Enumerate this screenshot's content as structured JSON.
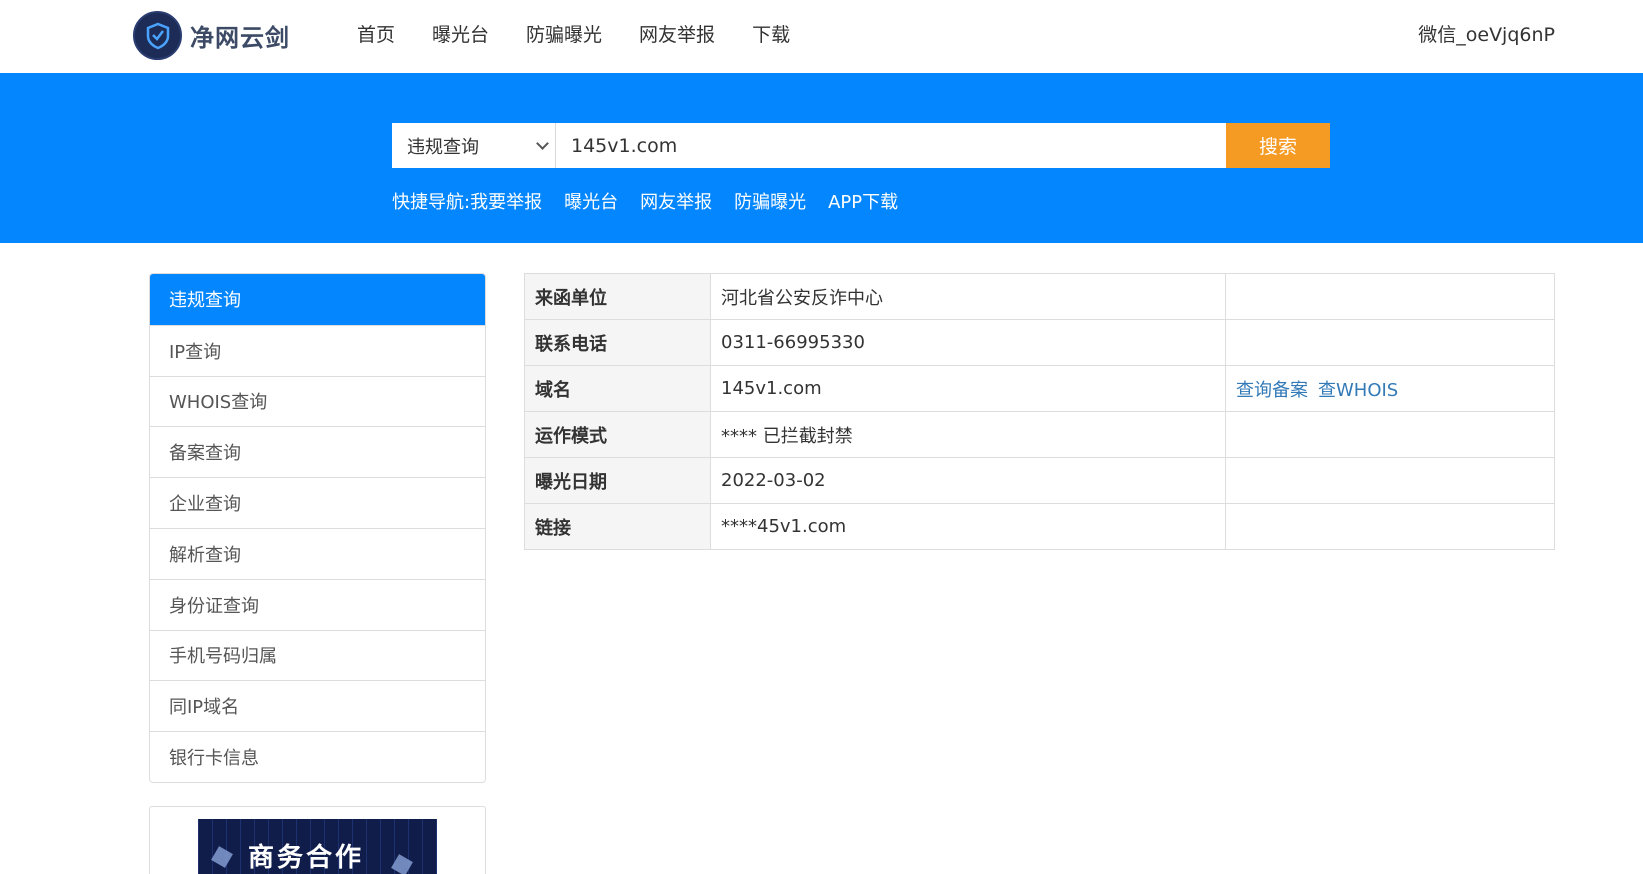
{
  "header": {
    "logo_text": "净网云剑",
    "nav": [
      "首页",
      "曝光台",
      "防骗曝光",
      "网友举报",
      "下载"
    ],
    "user": "微信_oeVjq6nP"
  },
  "search": {
    "select_value": "违规查询",
    "input_value": "145v1.com",
    "button_label": "搜索"
  },
  "quick_nav": {
    "label": "快捷导航:",
    "links": [
      "我要举报",
      "曝光台",
      "网友举报",
      "防骗曝光",
      "APP下载"
    ]
  },
  "sidebar": {
    "items": [
      {
        "label": "违规查询",
        "active": true
      },
      {
        "label": "IP查询"
      },
      {
        "label": "WHOIS查询"
      },
      {
        "label": "备案查询"
      },
      {
        "label": "企业查询"
      },
      {
        "label": "解析查询"
      },
      {
        "label": "身份证查询"
      },
      {
        "label": "手机号码归属"
      },
      {
        "label": "同IP域名"
      },
      {
        "label": "银行卡信息"
      }
    ],
    "promo_text": "商务合作"
  },
  "info_table": {
    "rows": [
      {
        "key": "来函单位",
        "value": "河北省公安反诈中心"
      },
      {
        "key": "联系电话",
        "value": "0311-66995330"
      },
      {
        "key": "域名",
        "value": "145v1.com",
        "links": [
          "查询备案",
          "查WHOIS"
        ]
      },
      {
        "key": "运作模式",
        "value": "**** 已拦截封禁"
      },
      {
        "key": "曝光日期",
        "value": "2022-03-02"
      },
      {
        "key": "链接",
        "value": "****45v1.com"
      }
    ]
  },
  "colors": {
    "primary_blue": "#0486fe",
    "search_button": "#f59a23",
    "link": "#337ab7"
  }
}
